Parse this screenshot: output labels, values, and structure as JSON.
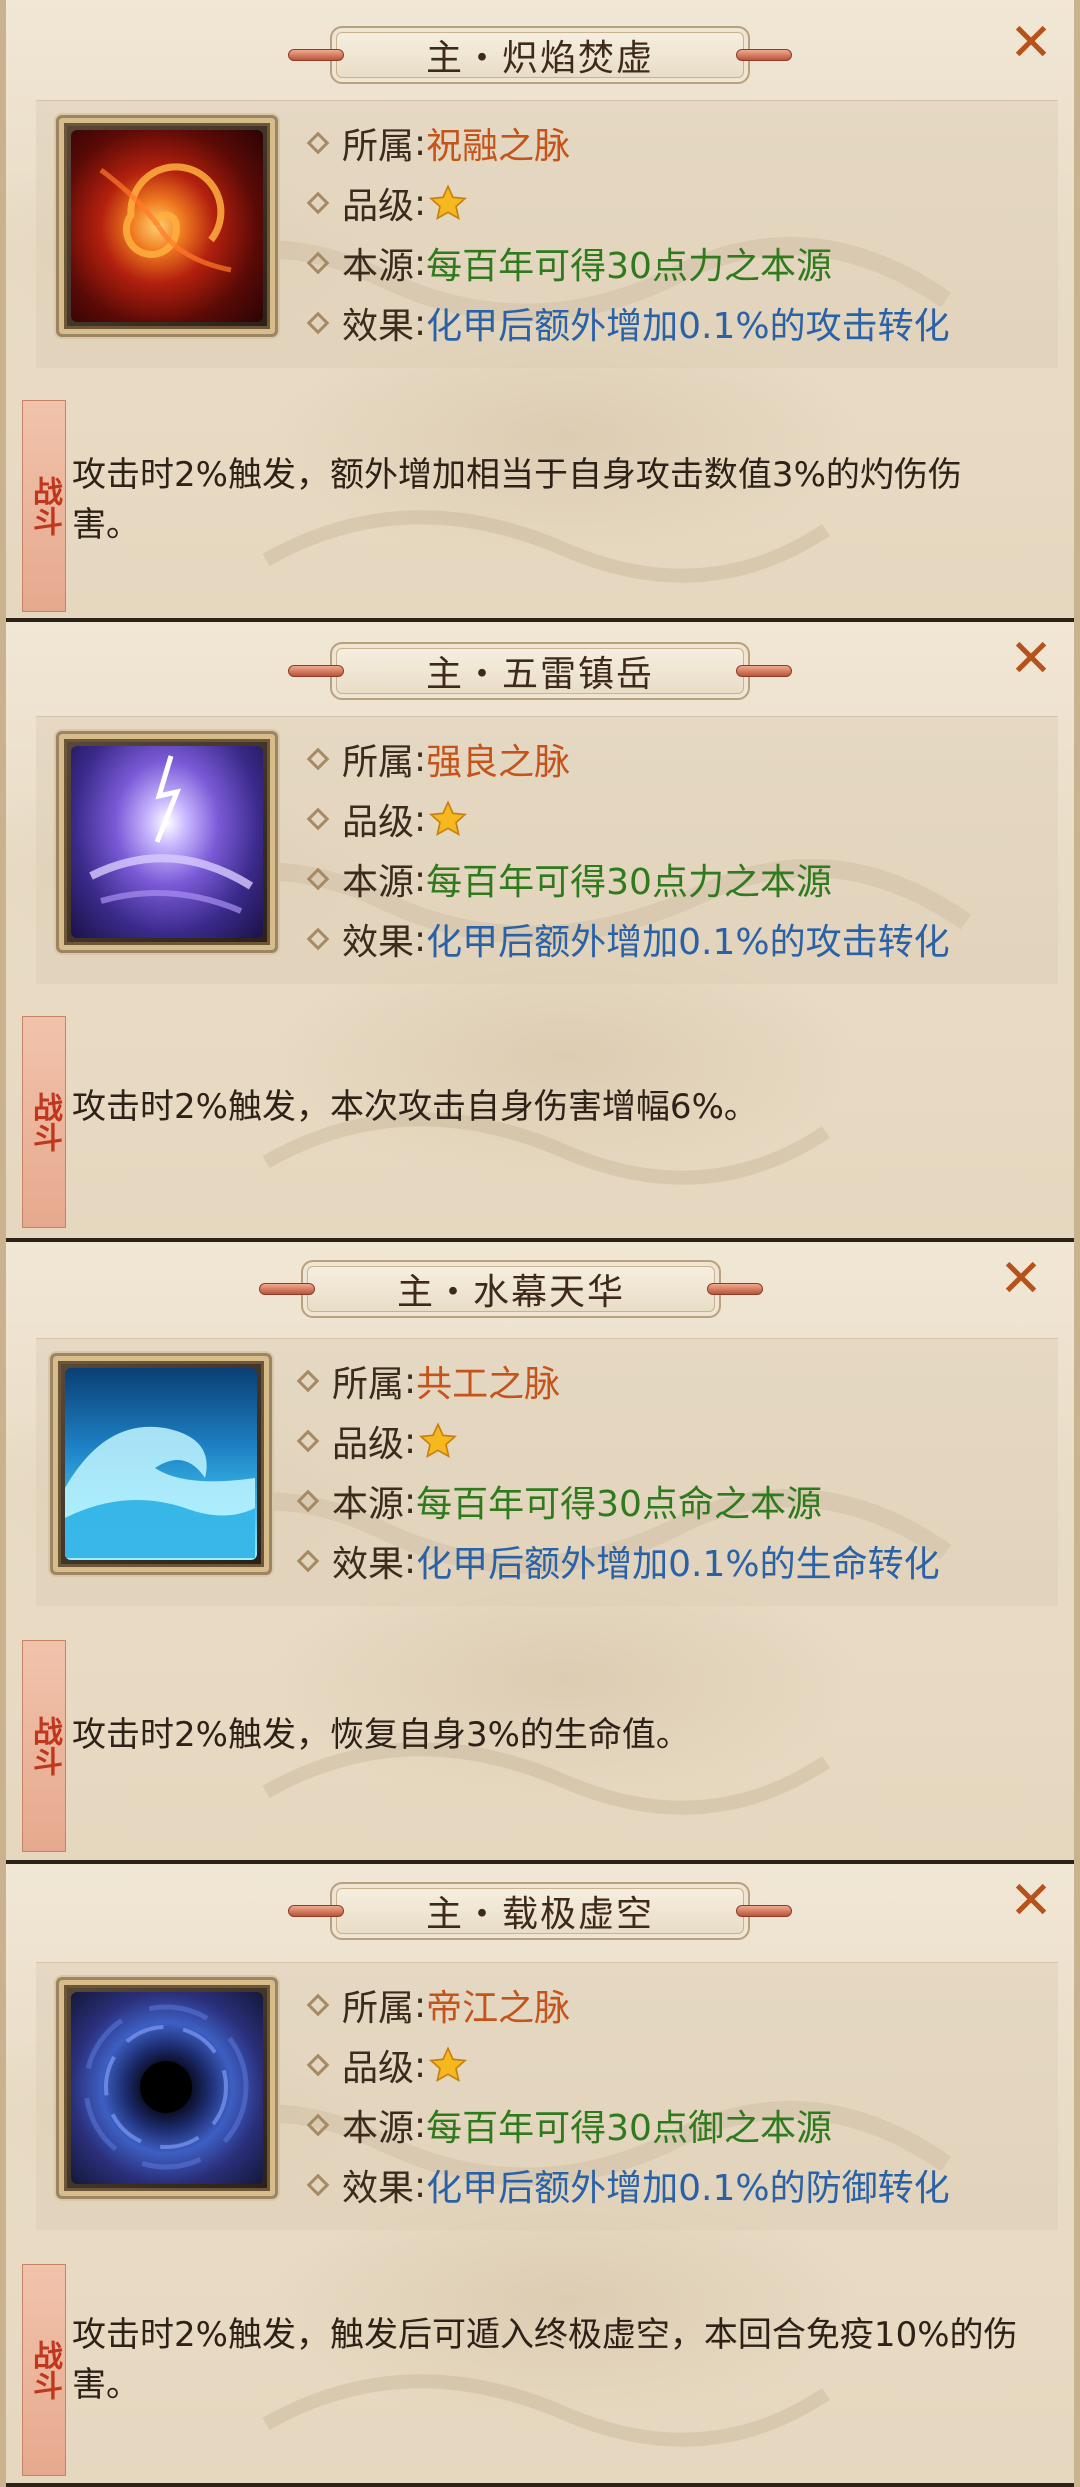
{
  "cards": [
    {
      "title": "主・炽焰焚虚",
      "close_glyph": "✕",
      "icon": "fire-swirl-icon",
      "labels": {
        "affiliation": "所属",
        "grade": "品级",
        "source": "本源",
        "effect": "效果"
      },
      "affiliation": "祝融之脉",
      "grade_stars": 1,
      "source": "每百年可得30点力之本源",
      "effect": "化甲后额外增加0.1%的攻击转化",
      "battle_tag": "战斗",
      "description": "攻击时2%触发，额外增加相当于自身攻击数值3%的灼伤伤害。"
    },
    {
      "title": "主・五雷镇岳",
      "close_glyph": "✕",
      "icon": "lightning-vortex-icon",
      "labels": {
        "affiliation": "所属",
        "grade": "品级",
        "source": "本源",
        "effect": "效果"
      },
      "affiliation": "强良之脉",
      "grade_stars": 1,
      "source": "每百年可得30点力之本源",
      "effect": "化甲后额外增加0.1%的攻击转化",
      "battle_tag": "战斗",
      "description": "攻击时2%触发，本次攻击自身伤害增幅6%。"
    },
    {
      "title": "主・水幕天华",
      "close_glyph": "✕",
      "icon": "water-wave-icon",
      "labels": {
        "affiliation": "所属",
        "grade": "品级",
        "source": "本源",
        "effect": "效果"
      },
      "affiliation": "共工之脉",
      "grade_stars": 1,
      "source": "每百年可得30点命之本源",
      "effect": "化甲后额外增加0.1%的生命转化",
      "battle_tag": "战斗",
      "description": "攻击时2%触发，恢复自身3%的生命值。"
    },
    {
      "title": "主・载极虚空",
      "close_glyph": "✕",
      "icon": "void-vortex-icon",
      "labels": {
        "affiliation": "所属",
        "grade": "品级",
        "source": "本源",
        "effect": "效果"
      },
      "affiliation": "帝江之脉",
      "grade_stars": 1,
      "source": "每百年可得30点御之本源",
      "effect": "化甲后额外增加0.1%的防御转化",
      "battle_tag": "战斗",
      "description": "攻击时2%触发，触发后可遁入终极虚空，本回合免疫10%的伤害。"
    }
  ],
  "colors": {
    "affiliation": "#c4541a",
    "source": "#2f7a1d",
    "effect": "#2a62a8",
    "close": "#b6531d"
  }
}
